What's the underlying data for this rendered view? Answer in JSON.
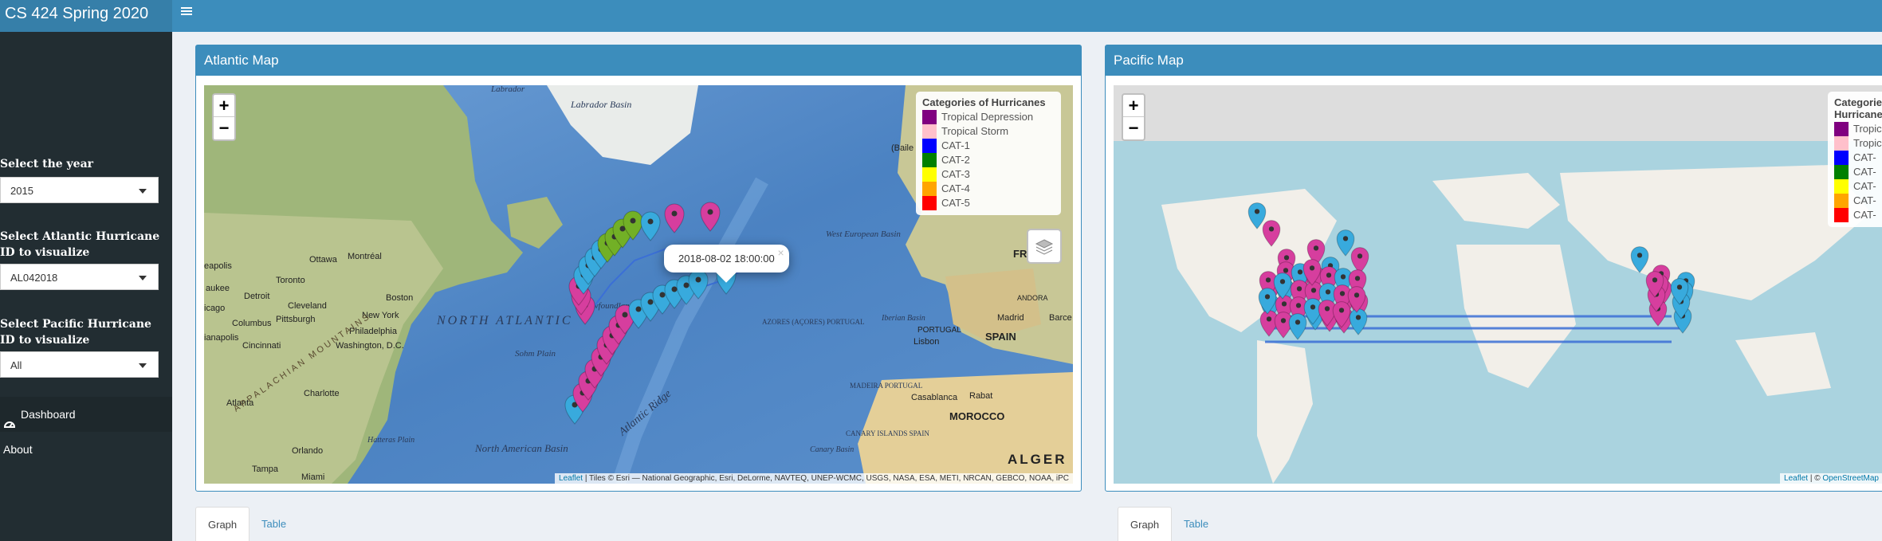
{
  "app": {
    "title": "CS 424 Spring 2020",
    "menu_icon": "hamburger-icon"
  },
  "sidebar": {
    "year": {
      "label": "Select the year",
      "value": "2015"
    },
    "atlantic_id": {
      "label": "Select Atlantic Hurricane ID to visualize",
      "value": "AL042018"
    },
    "pacific_id": {
      "label": "Select Pacific Hurricane ID to visualize",
      "value": "All"
    },
    "menu": [
      {
        "label": "Dashboard",
        "icon": "dashboard-icon",
        "active": true
      },
      {
        "label": "About",
        "active": false
      }
    ]
  },
  "atlantic": {
    "title": "Atlantic Map",
    "legend_title": "Categories of Hurricanes",
    "popup": "2018-08-02 18:00:00",
    "attribution_link": "Leaflet",
    "attribution_text": " | Tiles © Esri — National Geographic, Esri, DeLorme, NAVTEQ, UNEP-WCMC, USGS, NASA, ESA, METI, NRCAN, GEBCO, NOAA, iPC",
    "map_labels": [
      "Labrador",
      "Labrador Basin",
      "NORTH ATLANTIC",
      "Newfoundland Basin",
      "Sohm Plain",
      "Atlantic Ridge",
      "North American Basin",
      "Hatteras Plain",
      "West European Basin",
      "Iberian Basin",
      "AZORES (AÇORES) PORTUGAL",
      "MADEIRA PORTUGAL",
      "CANARY ISLANDS SPAIN",
      "Canary Basin",
      "SPAIN",
      "PORTUGAL",
      "MOROCCO",
      "ALGER",
      "Madrid",
      "Lisbon",
      "Casablanca",
      "Rabat",
      "ANDORA",
      "FRA",
      "Barce",
      "Montréal",
      "Ottawa",
      "Toronto",
      "Detroit",
      "Cleveland",
      "Pittsburgh",
      "Boston",
      "New York",
      "Philadelphia",
      "Washington, D.C.",
      "Columbus",
      "Cincinnati",
      "Charlotte",
      "Atlanta",
      "Orlando",
      "Tampa",
      "Miami",
      "aukee",
      "icago",
      "ianapolis",
      "eapolis",
      "APPALACHIAN MOUNTAINS",
      "(Baile"
    ]
  },
  "pacific": {
    "title": "Pacific Map",
    "legend_title": "Categories of Hurricanes",
    "attribution_link": "Leaflet",
    "attribution_sep": " | © ",
    "attribution_link2": "OpenStreetMap"
  },
  "legend_items": [
    {
      "label": "Tropical Depression",
      "short": "Tropic",
      "color": "#800080"
    },
    {
      "label": "Tropical Storm",
      "short": "Tropic",
      "color": "#ffc0cb"
    },
    {
      "label": "CAT-1",
      "short": "CAT-",
      "color": "#0000ff"
    },
    {
      "label": "CAT-2",
      "short": "CAT-",
      "color": "#008000"
    },
    {
      "label": "CAT-3",
      "short": "CAT-",
      "color": "#ffff00"
    },
    {
      "label": "CAT-4",
      "short": "CAT-",
      "color": "#ffa500"
    },
    {
      "label": "CAT-5",
      "short": "CAT-",
      "color": "#ff0000"
    }
  ],
  "zoom": {
    "in": "+",
    "out": "−"
  },
  "tabs": {
    "graph": "Graph",
    "table": "Table"
  },
  "colors": {
    "header": "#3c8dbc",
    "sidebar": "#222d32",
    "marker_magenta": "#d63e9e",
    "marker_blue": "#38aadd",
    "marker_green": "#72b026",
    "track": "#3b6fd6"
  }
}
